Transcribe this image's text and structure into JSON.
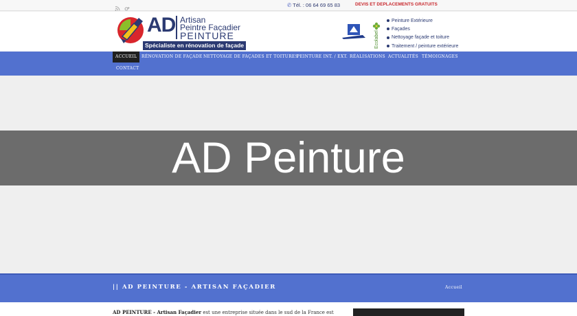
{
  "topbar": {
    "phone": "Tél. : 06 64 69 65 83",
    "promo": "DEVIS ET DEPLACEMENTS GRATUITS"
  },
  "logo": {
    "monogram": "AD",
    "line1": "Artisan",
    "line2": "Peintre Façadier",
    "line3": "PEINTURE",
    "tagline": "Spécialiste en rénovation de façade"
  },
  "labels": {
    "ecolabel": "Ecolabel"
  },
  "services": [
    "Peinture Extérieure",
    "Façades",
    "Nettoyage façade et toiture",
    "Traitement / peinture extérieure"
  ],
  "nav": [
    "ACCUEIL",
    "RÉNOVATION DE FAÇADE",
    "NETTOYAGE DE FAÇADES ET TOITURES",
    "PEINTURE INT. / EXT.",
    "RÉALISATIONS",
    "ACTUALITÉS",
    "TÉMOIGNAGES",
    "CONTACT"
  ],
  "hero": {
    "title": "AD Peinture"
  },
  "titlebar": {
    "title": "|| AD PEINTURE - ARTISAN FAÇADIER",
    "breadcrumb": "Accueil"
  },
  "content": {
    "lead_bold": "AD PEINTURE - Artisan Façadier",
    "lead_rest": " est une entreprise située dans le sud de la France est"
  },
  "colors": {
    "nav_blue": "#5271cf",
    "brand_navy": "#2b3a72",
    "promo_red": "#c8282d"
  }
}
